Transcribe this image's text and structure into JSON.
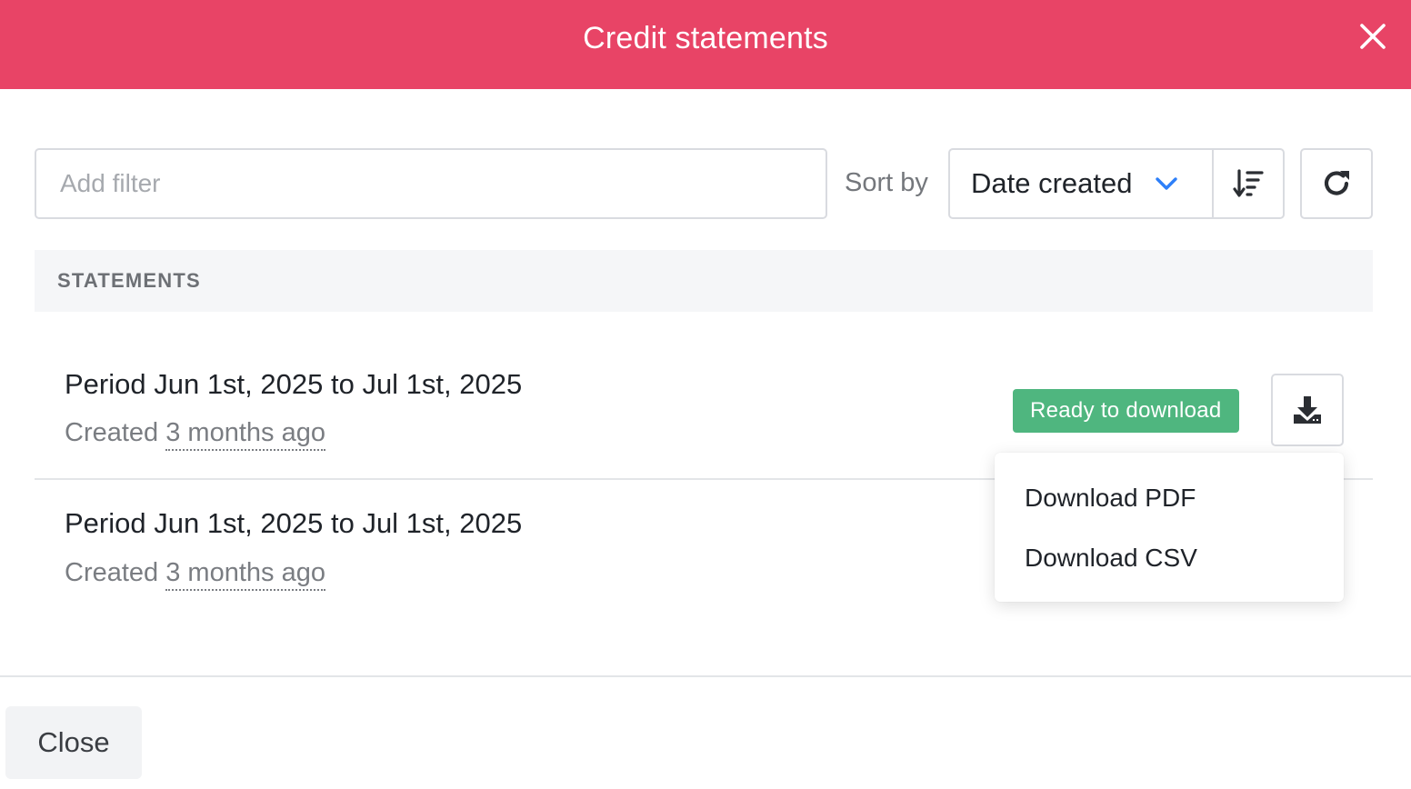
{
  "modal": {
    "title": "Credit statements",
    "header_color": "#e84466",
    "close_icon": "close-icon"
  },
  "toolbar": {
    "filter_placeholder": "Add filter",
    "sort_label": "Sort by",
    "sort_value": "Date created",
    "sort_chevron_color": "#2d7ff9",
    "sort_direction_icon": "sort-descending-icon",
    "refresh_icon": "refresh-icon"
  },
  "section": {
    "label": "STATEMENTS"
  },
  "statements": [
    {
      "period": "Period Jun 1st, 2025 to Jul 1st, 2025",
      "created_prefix": "Created",
      "created_ago": "3 months ago",
      "status": "Ready to download",
      "status_color": "#4fb67f",
      "download_icon": "download-icon"
    },
    {
      "period": "Period Jun 1st, 2025 to Jul 1st, 2025",
      "created_prefix": "Created",
      "created_ago": "3 months ago"
    }
  ],
  "dropdown": {
    "items": [
      "Download PDF",
      "Download CSV"
    ]
  },
  "footer": {
    "close_label": "Close"
  }
}
